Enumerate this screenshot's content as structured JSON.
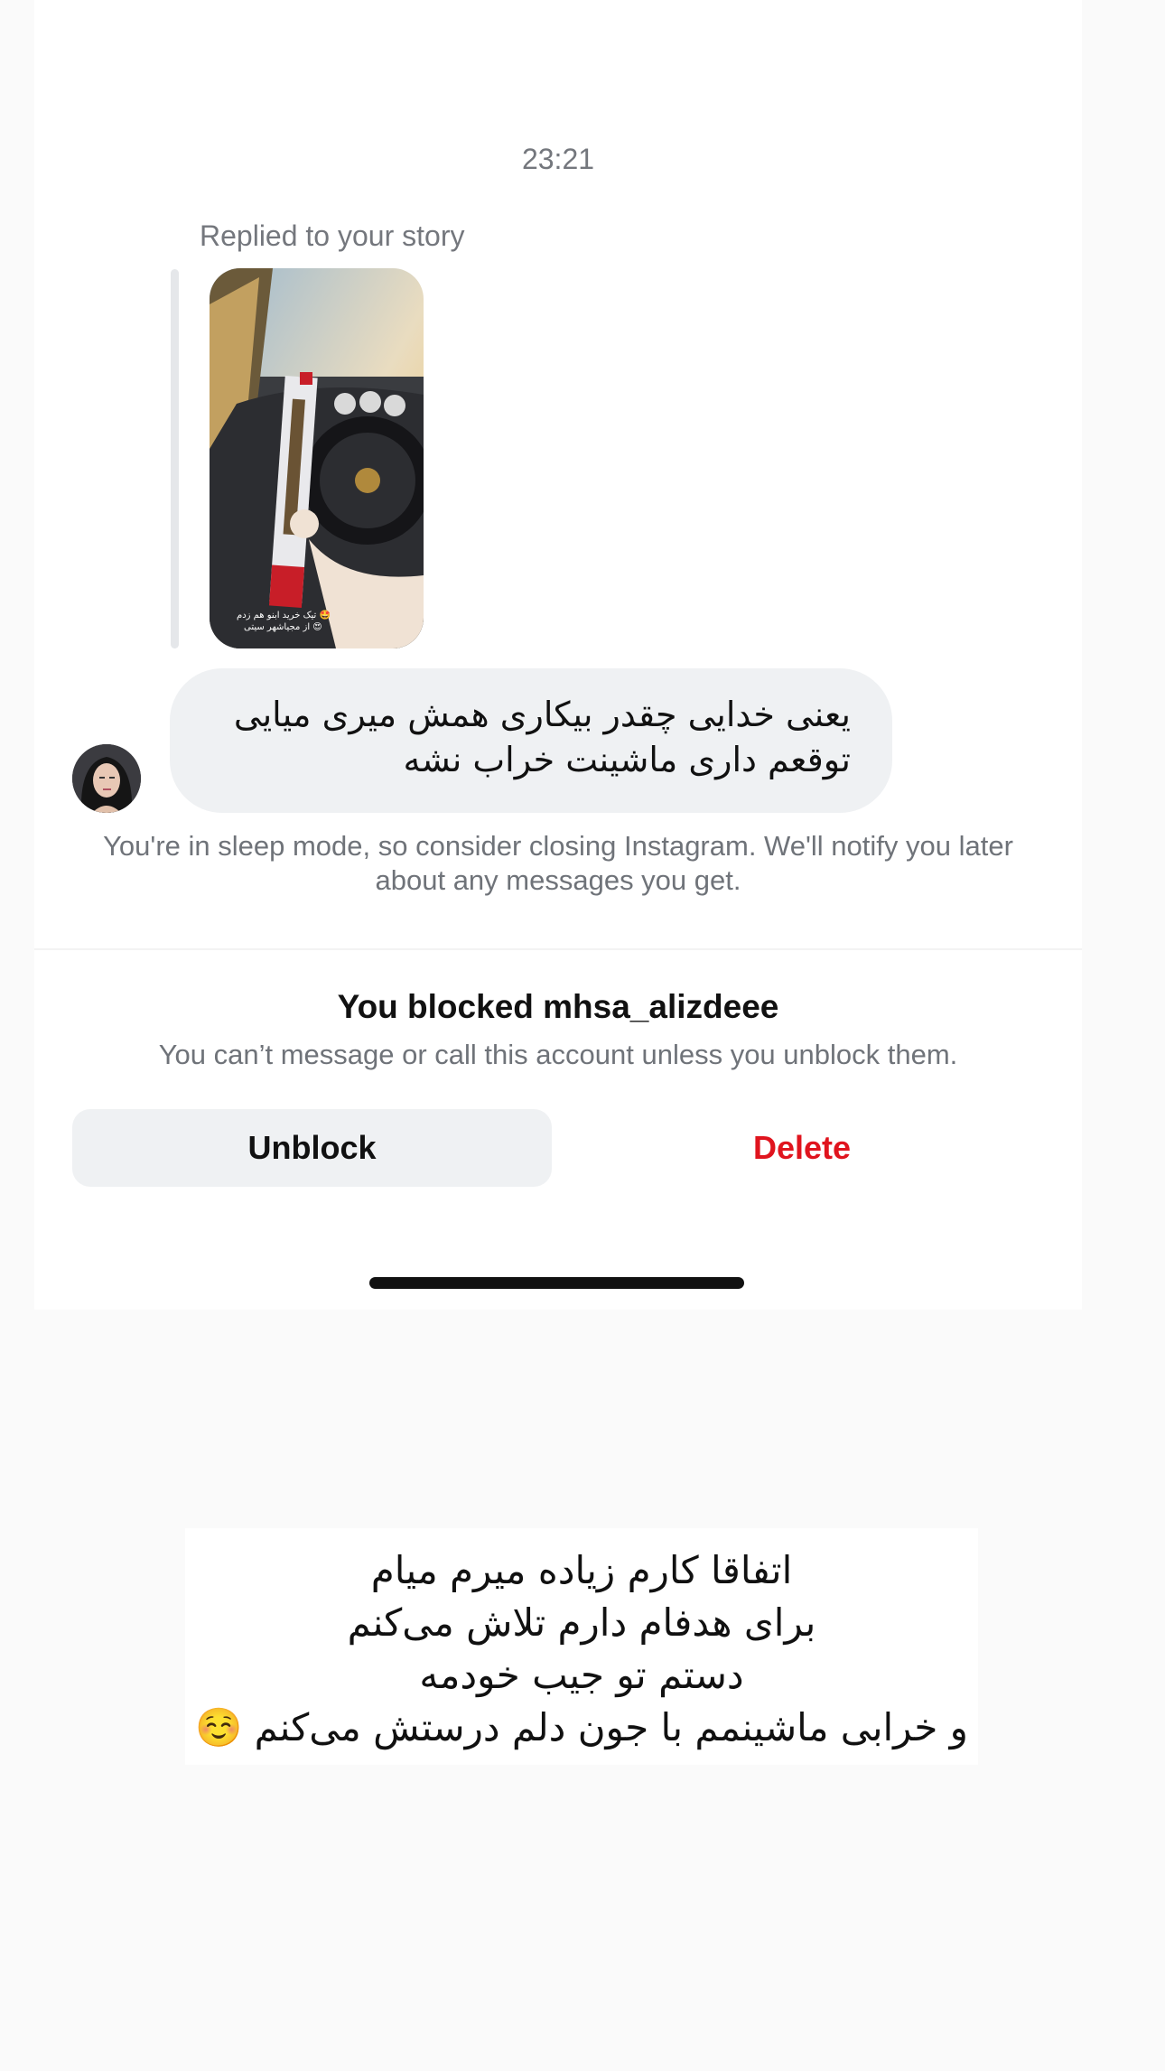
{
  "chat": {
    "time": "23:21",
    "replied_label": "Replied to your story",
    "story_overlay_lines": [
      "تیک خرید ابنو هم زدم 🤩",
      "از مجیاشهر سیتی 😍"
    ],
    "message_lines": [
      "یعنی خدایی چقدر بیکاری همش میری میایی",
      "توقعم داری ماشینت خراب نشه"
    ],
    "sleep_notice": "You're in sleep mode, so consider closing Instagram. We'll notify you later about any messages you get."
  },
  "blocked": {
    "title": "You blocked mhsa_alizdeee",
    "subtitle": "You can’t message or call this account unless you unblock them.",
    "unblock_label": "Unblock",
    "delete_label": "Delete",
    "delete_color": "#e0141e"
  },
  "caption": {
    "lines": [
      "اتفاقا کارم زیاده میرم میام",
      "برای هدفام دارم تلاش می‌کنم",
      "دستم تو جیب خودمه",
      "و خرابی ماشینمم با جون دلم درستش می‌کنم ☺️"
    ]
  }
}
